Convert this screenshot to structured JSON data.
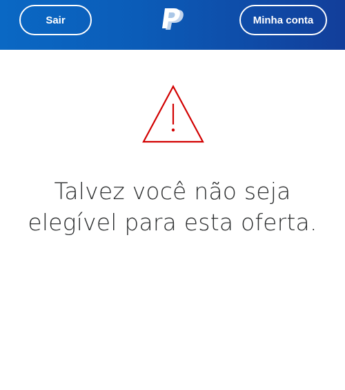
{
  "header": {
    "logout_label": "Sair",
    "account_label": "Minha conta",
    "logo_icon": "paypal-logo-icon",
    "background_color": "#0b5cb8"
  },
  "main": {
    "warning_icon": "warning-triangle-icon",
    "warning_color": "#d20000",
    "message": "Talvez você não seja elegível para esta oferta."
  }
}
